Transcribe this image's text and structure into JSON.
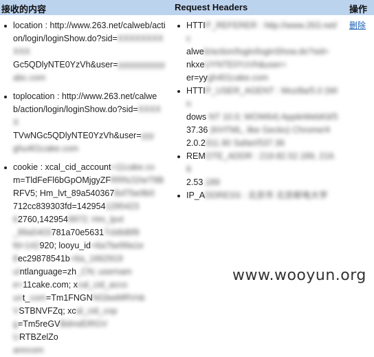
{
  "header": {
    "col_received": "接收的内容",
    "col_headers": "Request Headers",
    "col_action": "操作"
  },
  "received": {
    "location": {
      "line1": "location : http://www.263.net/calweb/acti",
      "line2": "on/login/loginShow.do?sid=",
      "line2_hidden": "XXXXXXXXXXX",
      "line3": "Gc5QDlyNTE0YzVh&user=",
      "line3_hidden": "yyyyyyyyyyy",
      "line4_hidden": "abc.com"
    },
    "toplocation": {
      "line1": "toplocation : http://www.263.net/calwe",
      "line2": "b/action/login/loginShow.do?sid=",
      "line2_hidden": "XXXXX",
      "line3": "TVwNGc5QDlyNTE0YzVh&user=",
      "line3_hidden": "yyy",
      "line4_hidden": "ghu401cake.com"
    },
    "cookie": {
      "l1": "cookie : xcal_cid_account",
      "l1h": "=11cake.co",
      "l2": "m=TldFeFl6bGpOMjgyZF",
      "l2h": "RRNJ1heT8B",
      "l3": "RFV5; Hm_lvt_89a540367",
      "l3h": "8xf7be9b0",
      "l4": "712cc839303fd=142954",
      "l4h": "1295423",
      "l5h": "6",
      "l5": "2760,142954",
      "l5h2": "9972; Hm_lpvt",
      "l6h": "_89a5403",
      "l6": "781a70e5631",
      "l6h2": "7cb8d6f9",
      "l7h": "fd=142",
      "l7": "920; looyu_id",
      "l7h2": "=6a7be99a1e",
      "l8h": "8",
      "l8": "ec29878541b",
      "l8h2": "=6a_1662919",
      "l9h": "ul",
      "l9": "ntlanguage=zh",
      "l9h2": "_CN; usernam",
      "l10h": "e=",
      "l10": "11cake.com; x",
      "l10h2": "cal_cid_acco",
      "l11h": "un",
      "l11": "t_",
      "l11h2": "com",
      "l11b": "=Tm1FNGN",
      "l11h3": "NGbwMRVnb",
      "l12h": "V",
      "l12": "STBNVFZq; xc",
      "l12h2": "al_cid_cop",
      "l13h": "g",
      "l13": "=Tm5reGV",
      "l13h2": "BdmdDRGV",
      "l14h": "U",
      "l14": "RTBZelZo",
      "l15h": "anncom"
    }
  },
  "headers": {
    "h1": "HTTI",
    "h1h": "P_REFERER : http://www.263.net/c",
    "h2": "alwe",
    "h2h": "b/action/login/loginShow.do?sid=",
    "h3": "nkxe",
    "h3h": "UYNTE0YzVh&user=",
    "h4": "er=yy",
    "h4h": "gh401cake.com",
    "h5": "HTTI",
    "h5h": "P_USER_AGENT : Mozilla/5.0 (Win",
    "h6": "dows",
    "h6h": " NT 10.0; WOW64) AppleWebKit/5",
    "h7": "37.36",
    "h7h": " (KHTML, like Gecko) Chrome/4",
    "h8": "2.0.2",
    "h8h": "311.90 Safari/537.36",
    "h9": "REM",
    "h9h": "OTE_ADDR : 219.82.52.189, 219.6",
    "h10": "2.53",
    "h10h": ".189",
    "h11": "IP_A",
    "h11h": "DDRESS : 北京市 北京邮电大学"
  },
  "action": {
    "delete": "删除"
  },
  "watermark": "www.wooyun.org"
}
